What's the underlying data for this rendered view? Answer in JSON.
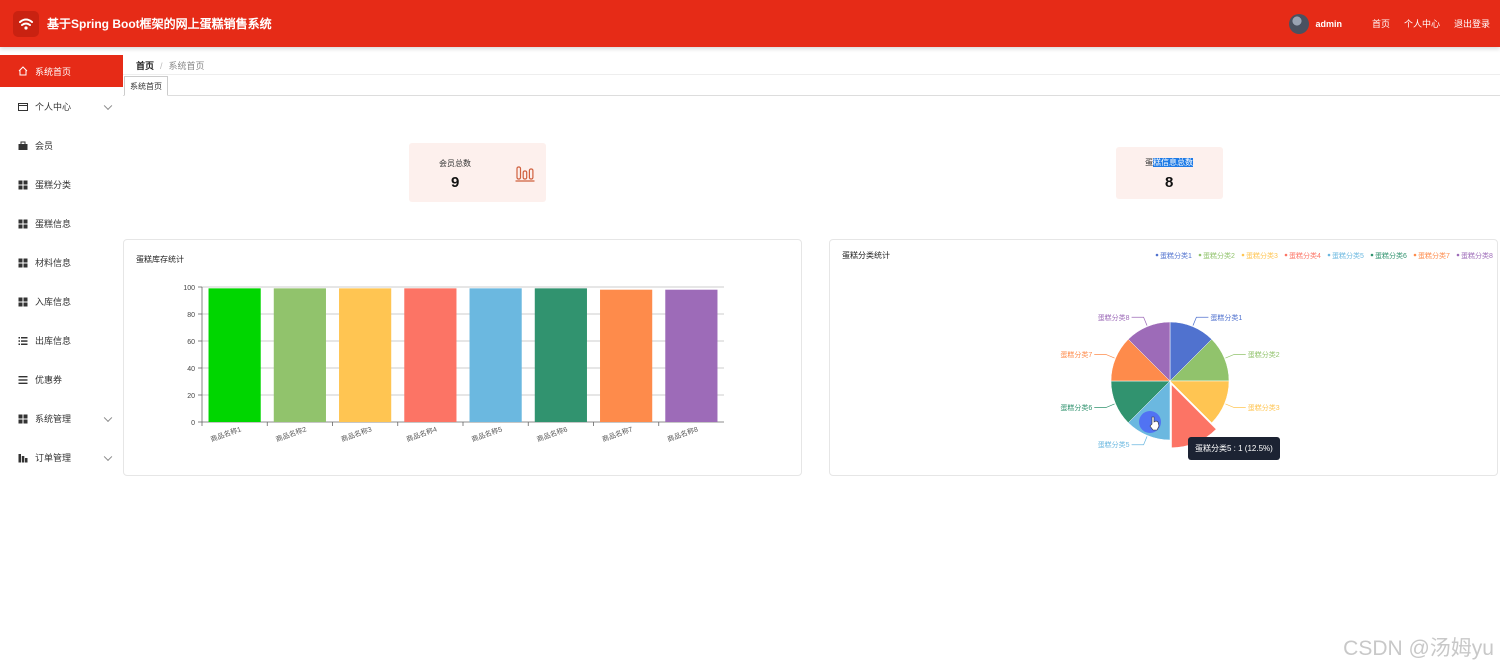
{
  "header": {
    "title": "基于Spring Boot框架的网上蛋糕销售系统",
    "username": "admin",
    "links": [
      "首页",
      "个人中心",
      "退出登录"
    ]
  },
  "sidebar": {
    "items": [
      {
        "label": "系统首页",
        "icon": "home-icon",
        "active": true,
        "expandable": false
      },
      {
        "label": "个人中心",
        "icon": "id-card-icon",
        "active": false,
        "expandable": true
      },
      {
        "label": "会员",
        "icon": "briefcase-icon",
        "active": false,
        "expandable": false
      },
      {
        "label": "蛋糕分类",
        "icon": "grid-icon",
        "active": false,
        "expandable": false
      },
      {
        "label": "蛋糕信息",
        "icon": "grid-icon",
        "active": false,
        "expandable": false
      },
      {
        "label": "材料信息",
        "icon": "grid-icon",
        "active": false,
        "expandable": false
      },
      {
        "label": "入库信息",
        "icon": "grid-icon",
        "active": false,
        "expandable": false
      },
      {
        "label": "出库信息",
        "icon": "list-icon",
        "active": false,
        "expandable": false
      },
      {
        "label": "优惠券",
        "icon": "menu-lines-icon",
        "active": false,
        "expandable": false
      },
      {
        "label": "系统管理",
        "icon": "grid-icon",
        "active": false,
        "expandable": true
      },
      {
        "label": "订单管理",
        "icon": "bar-chart-icon",
        "active": false,
        "expandable": true
      }
    ]
  },
  "breadcrumb": {
    "home": "首页",
    "separator": "/",
    "current": "系统首页"
  },
  "tabs": [
    {
      "label": "系统首页"
    }
  ],
  "stats": [
    {
      "label": "会员总数",
      "value": "9",
      "icon": "bar-chart-outline-icon"
    },
    {
      "label_prefix": "蛋",
      "label_highlight": "糕信息总数",
      "value": "8"
    }
  ],
  "colors": {
    "header": "#e62b17",
    "card_bg": "#fdf0ed",
    "highlight": "#1e7ae6"
  },
  "bar_chart": {
    "title": "蛋糕库存统计",
    "chart_data": {
      "type": "bar",
      "categories": [
        "商品名称1",
        "商品名称2",
        "商品名称3",
        "商品名称4",
        "商品名称5",
        "商品名称6",
        "商品名称7",
        "商品名称8"
      ],
      "values": [
        99,
        99,
        99,
        99,
        99,
        99,
        98,
        98
      ],
      "colors": [
        "#00d600",
        "#91c36c",
        "#ffc552",
        "#fc7465",
        "#6bb8e0",
        "#31936f",
        "#fe8b4b",
        "#9d6bb8"
      ],
      "ylim": [
        0,
        100
      ],
      "yticks": [
        0,
        20,
        40,
        60,
        80,
        100
      ],
      "grid": true
    }
  },
  "pie_chart": {
    "title": "蛋糕分类统计",
    "legend_position": "top-right",
    "chart_data": {
      "type": "pie",
      "labels": [
        "蛋糕分类1",
        "蛋糕分类2",
        "蛋糕分类3",
        "蛋糕分类4",
        "蛋糕分类5",
        "蛋糕分类6",
        "蛋糕分类7",
        "蛋糕分类8"
      ],
      "values": [
        1,
        1,
        1,
        1,
        1,
        1,
        1,
        1
      ],
      "colors": [
        "#5072cf",
        "#91c36c",
        "#ffc552",
        "#fc7465",
        "#6bb8e0",
        "#31936f",
        "#fe8b4b",
        "#9d6bb8"
      ],
      "highlighted_index": 3
    },
    "tooltip": "蛋糕分类5 : 1 (12.5%)"
  },
  "watermark": "CSDN @汤姆yu"
}
